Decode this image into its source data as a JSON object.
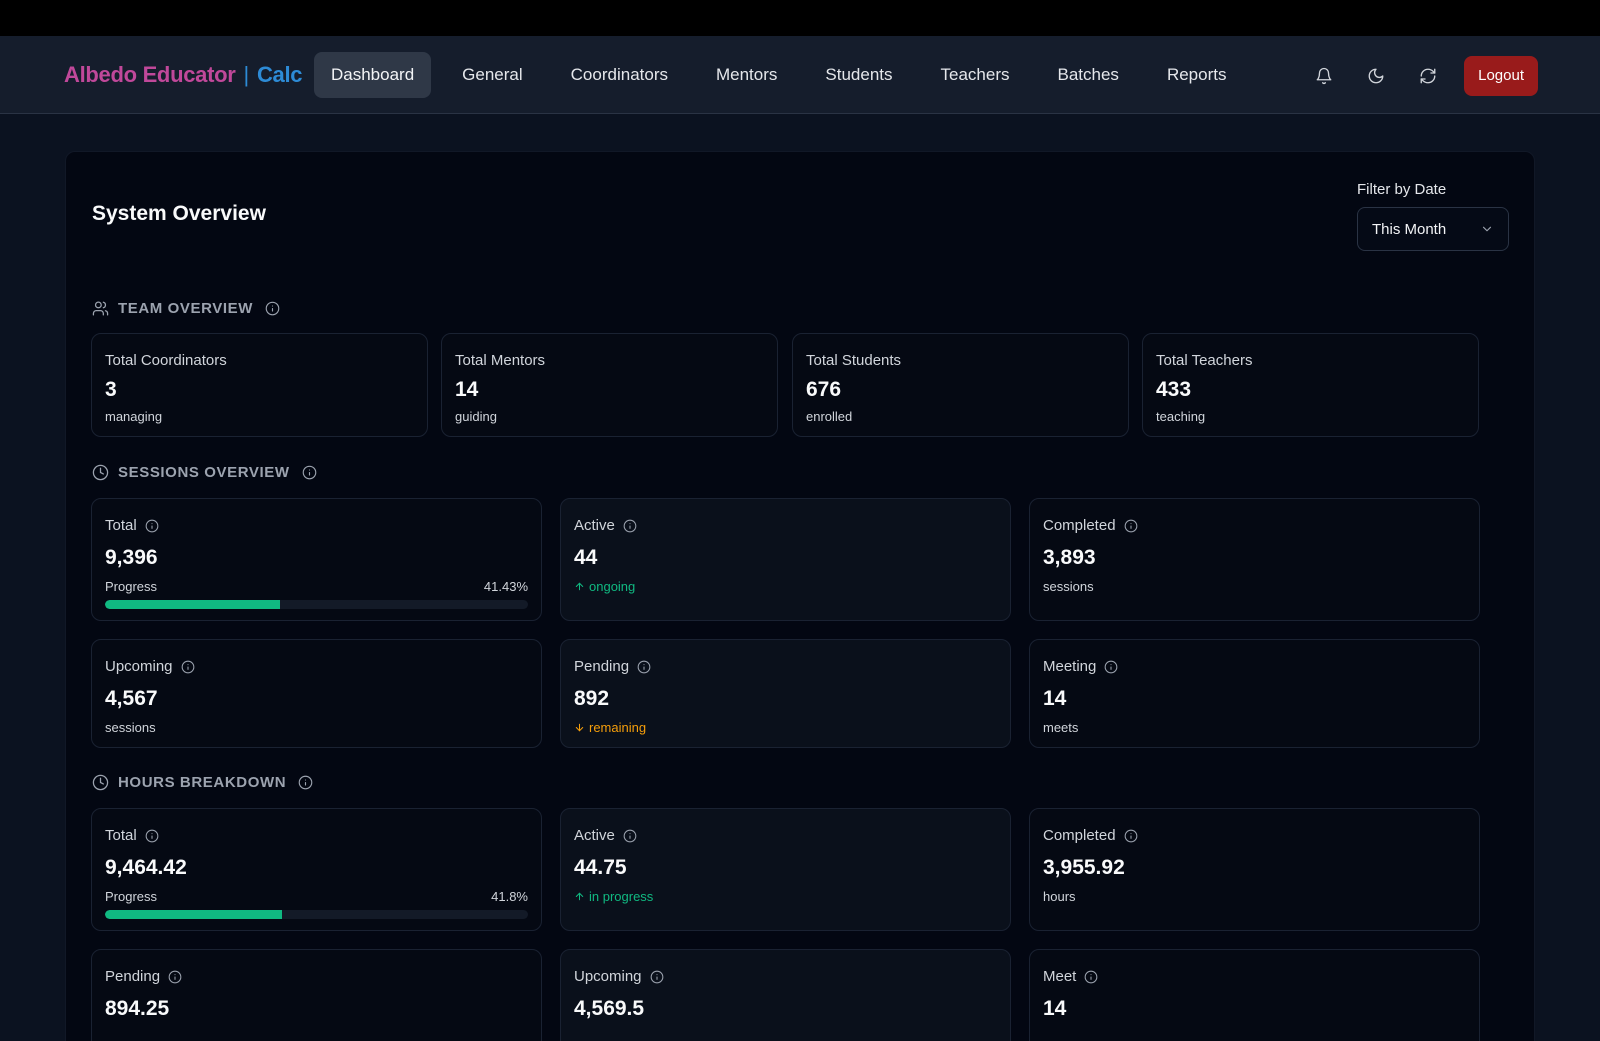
{
  "brand": {
    "name": "Albedo Educator",
    "separator": "|",
    "product": "Calc"
  },
  "nav": {
    "items": [
      {
        "label": "Dashboard",
        "active": true
      },
      {
        "label": "General"
      },
      {
        "label": "Coordinators"
      },
      {
        "label": "Mentors"
      },
      {
        "label": "Students"
      },
      {
        "label": "Teachers"
      },
      {
        "label": "Batches"
      },
      {
        "label": "Reports"
      }
    ],
    "icons": [
      "bell-icon",
      "moon-icon",
      "refresh-icon"
    ],
    "logout_label": "Logout"
  },
  "page": {
    "title": "System Overview",
    "filter_label": "Filter by Date",
    "filter_value": "This Month"
  },
  "team": {
    "title": "TEAM OVERVIEW",
    "cards": [
      {
        "label": "Total Coordinators",
        "value": "3",
        "sub": "managing"
      },
      {
        "label": "Total Mentors",
        "value": "14",
        "sub": "guiding"
      },
      {
        "label": "Total Students",
        "value": "676",
        "sub": "enrolled"
      },
      {
        "label": "Total Teachers",
        "value": "433",
        "sub": "teaching"
      }
    ]
  },
  "sessions": {
    "title": "SESSIONS OVERVIEW",
    "total": {
      "label": "Total",
      "value": "9,396",
      "progress_label": "Progress",
      "progress_text": "41.43%",
      "progress": 41.43
    },
    "active": {
      "label": "Active",
      "value": "44",
      "sub": "ongoing"
    },
    "completed": {
      "label": "Completed",
      "value": "3,893",
      "sub": "sessions"
    },
    "upcoming": {
      "label": "Upcoming",
      "value": "4,567",
      "sub": "sessions"
    },
    "pending": {
      "label": "Pending",
      "value": "892",
      "sub": "remaining"
    },
    "meeting": {
      "label": "Meeting",
      "value": "14",
      "sub": "meets"
    }
  },
  "hours": {
    "title": "HOURS BREAKDOWN",
    "total": {
      "label": "Total",
      "value": "9,464.42",
      "progress_label": "Progress",
      "progress_text": "41.8%",
      "progress": 41.8
    },
    "active": {
      "label": "Active",
      "value": "44.75",
      "sub": "in progress"
    },
    "completed": {
      "label": "Completed",
      "value": "3,955.92",
      "sub": "hours"
    },
    "pending": {
      "label": "Pending",
      "value": "894.25"
    },
    "upcoming": {
      "label": "Upcoming",
      "value": "4,569.5"
    },
    "meet": {
      "label": "Meet",
      "value": "14"
    }
  },
  "colors": {
    "brand_pink": "#c0489a",
    "brand_blue": "#2d8bd6",
    "progress_green": "#10b981",
    "warning_orange": "#f59e0b",
    "logout_red": "#991b1b"
  }
}
